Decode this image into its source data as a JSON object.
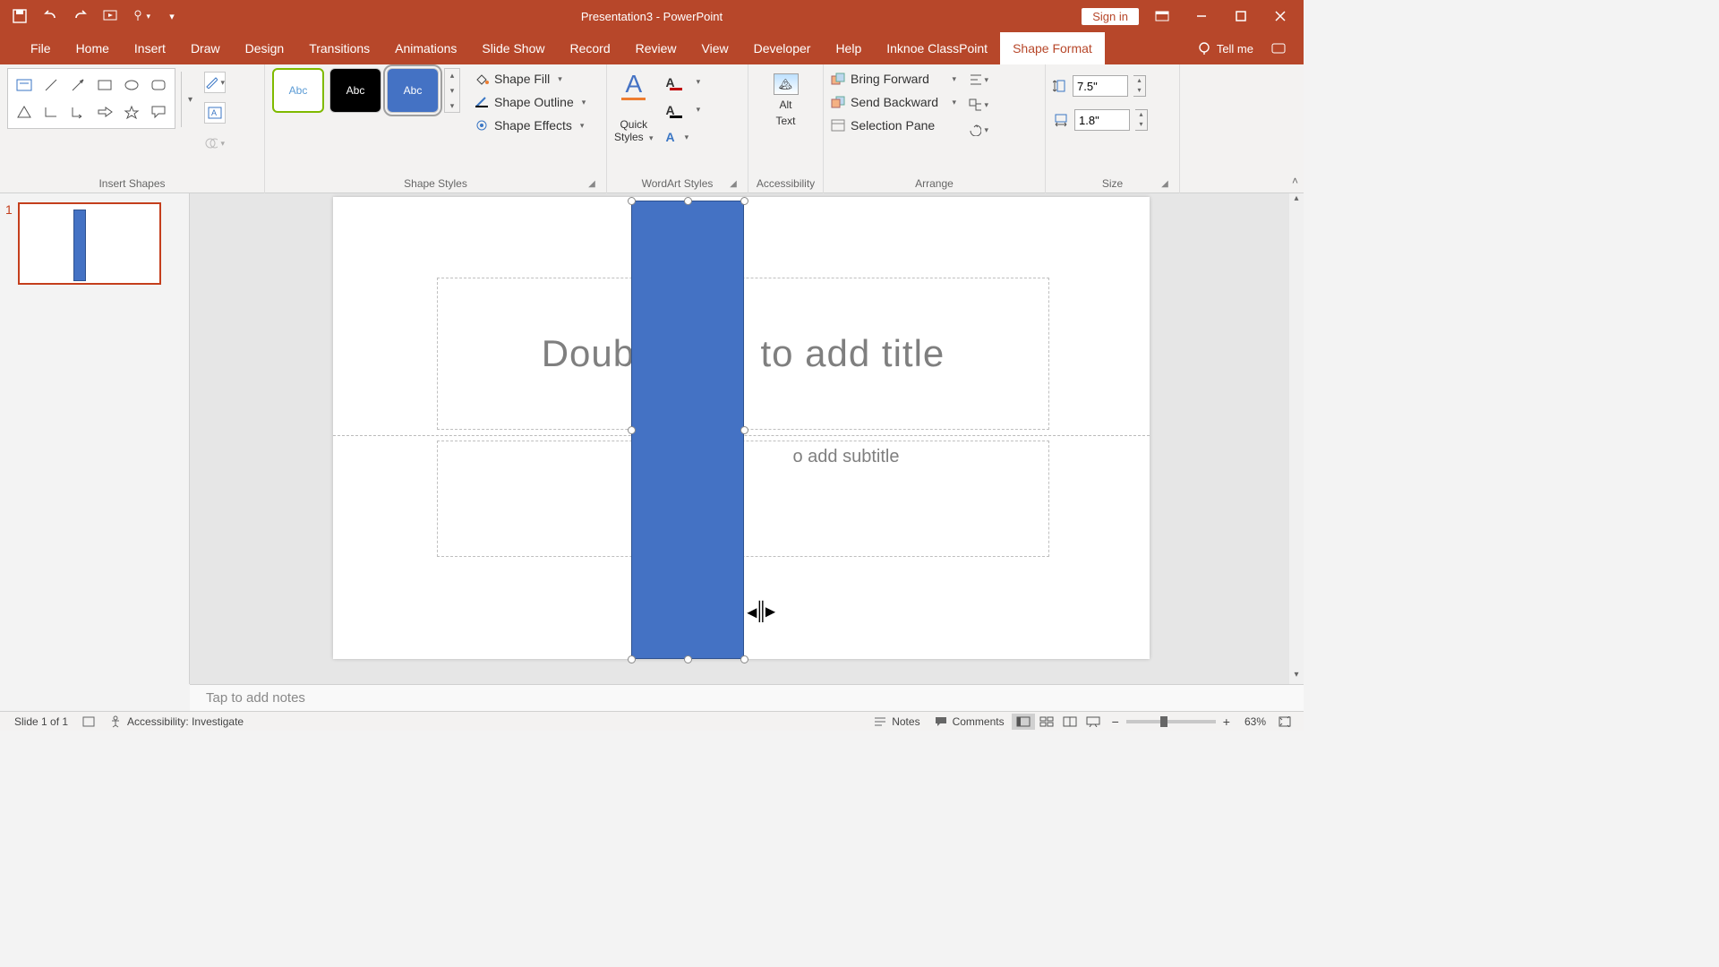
{
  "titlebar": {
    "doc_title": "Presentation3  -  PowerPoint",
    "signin": "Sign in"
  },
  "tabs": {
    "file": "File",
    "home": "Home",
    "insert": "Insert",
    "draw": "Draw",
    "design": "Design",
    "transitions": "Transitions",
    "animations": "Animations",
    "slideshow": "Slide Show",
    "record": "Record",
    "review": "Review",
    "view": "View",
    "developer": "Developer",
    "help": "Help",
    "classpoint": "Inknoe ClassPoint",
    "shapeformat": "Shape Format",
    "tellme": "Tell me"
  },
  "ribbon": {
    "groups": {
      "insert_shapes": "Insert Shapes",
      "shape_styles": "Shape Styles",
      "wordart_styles": "WordArt Styles",
      "accessibility": "Accessibility",
      "arrange": "Arrange",
      "size": "Size"
    },
    "shape_styles": {
      "abc": "Abc",
      "fill": "Shape Fill",
      "outline": "Shape Outline",
      "effects": "Shape Effects"
    },
    "wordart": {
      "quick_line1": "Quick",
      "quick_line2": "Styles"
    },
    "accessibility": {
      "alt_line1": "Alt",
      "alt_line2": "Text"
    },
    "arrange": {
      "bring_forward": "Bring Forward",
      "send_backward": "Send Backward",
      "selection_pane": "Selection Pane"
    },
    "size": {
      "height": "7.5\"",
      "width": "1.8\""
    }
  },
  "thumbnails": {
    "slide1_num": "1"
  },
  "slide": {
    "title_placeholder_left": "Doubl",
    "title_placeholder_right": "to add title",
    "subtitle_placeholder_right": "o add subtitle"
  },
  "notes": {
    "placeholder": "Tap to add notes"
  },
  "status": {
    "slide": "Slide 1 of 1",
    "accessibility": "Accessibility: Investigate",
    "notes": "Notes",
    "comments": "Comments",
    "zoom": "63%"
  }
}
